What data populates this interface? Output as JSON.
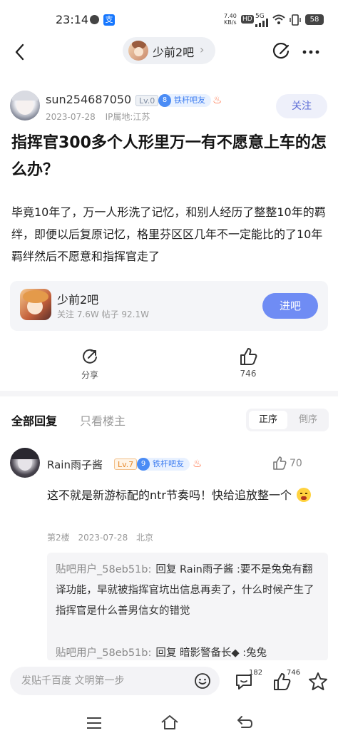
{
  "status_bar": {
    "time": "23:14",
    "speed_value": "7.40",
    "speed_unit": "KB/s",
    "hd": "HD",
    "network": "5G",
    "battery": "58"
  },
  "nav": {
    "forum_name": "少前2吧"
  },
  "post": {
    "author": "sun254687050",
    "level": "Lv.0",
    "fan_level": "8",
    "fan_title": "铁杆吧友",
    "date": "2023-07-28",
    "ip_location": "IP属地:江苏",
    "follow_label": "关注",
    "title": "指挥官300多个人形里万一有不愿意上车的怎么办？",
    "body": "毕竟10年了，万一人形洗了记忆，和别人经历了整整10年的羁绊，即便以后复原记忆，格里芬区区几年不一定能比的了10年羁绊然后不愿意和指挥官走了"
  },
  "forum_card": {
    "name": "少前2吧",
    "stats": "关注 7.6W  帖子 92.1W",
    "enter_label": "进吧"
  },
  "actions": {
    "share_label": "分享",
    "like_count": "746"
  },
  "comments_header": {
    "all_replies": "全部回复",
    "author_only": "只看楼主",
    "order_asc": "正序",
    "order_desc": "倒序"
  },
  "reply": {
    "author": "Rain雨子酱",
    "level": "Lv.7",
    "fan_level": "9",
    "fan_title": "铁杆吧友",
    "likes": "70",
    "text": "这不就是新游标配的ntr节奏吗！快给追放整一个",
    "floor": "第2楼",
    "date": "2023-07-28",
    "location": "北京",
    "subreplies": [
      {
        "user": "贴吧用户_58eb51b:",
        "content": "回复 Rain雨子酱 :要不是兔兔有翻译功能，早就被指挥官坑出信息再卖了，什么时候产生了指挥官是什么善男信女的错觉"
      },
      {
        "user": "贴吧用户_58eb51b:",
        "content": "回复 暗影警备长◆ :兔兔"
      }
    ]
  },
  "bottom_bar": {
    "input_placeholder": "发贴千百度 文明第一步",
    "comment_count": "182",
    "like_count": "746"
  },
  "colors": {
    "accent": "#6f8cf4",
    "follow_text": "#5b6bd6",
    "fan_tag": "#4b8cf5"
  }
}
